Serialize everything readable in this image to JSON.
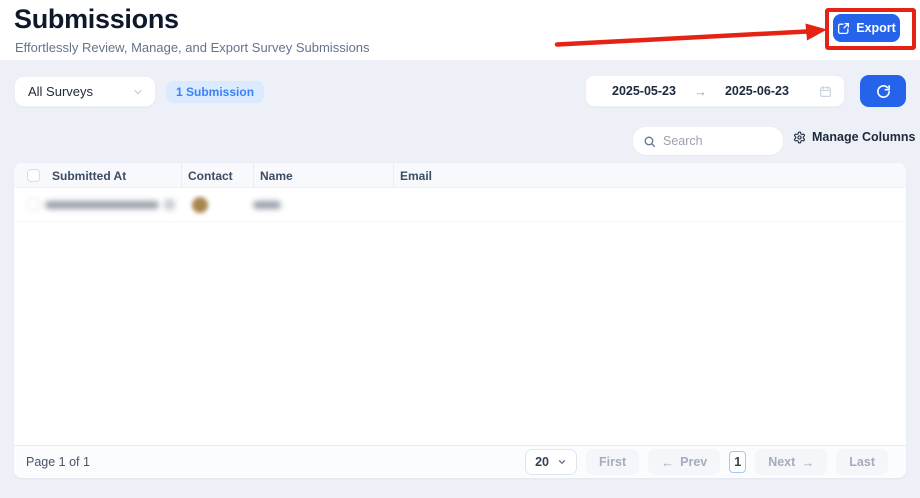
{
  "page": {
    "title": "Submissions",
    "subtitle": "Effortlessly Review, Manage, and Export Survey Submissions"
  },
  "toolbar": {
    "export_label": "Export"
  },
  "filters": {
    "survey_filter_value": "All Surveys",
    "submission_count": "1 Submission",
    "date_from": "2025-05-23",
    "date_to": "2025-06-23",
    "search_placeholder": "Search",
    "manage_columns_label": "Manage Columns"
  },
  "table": {
    "columns": [
      "Submitted At",
      "Contact",
      "Name",
      "Email"
    ]
  },
  "pagination": {
    "summary": "Page 1 of 1",
    "page_size": "20",
    "first": "First",
    "prev": "Prev",
    "current_page": "1",
    "next": "Next",
    "last": "Last"
  },
  "icons": {
    "range_arrow": "→",
    "prev_arrow": "←",
    "next_arrow": "→"
  },
  "colors": {
    "accent_blue": "#2563eb",
    "badge_bg": "#dbeafe",
    "badge_text": "#3b82f6",
    "annotation_red": "#e42315"
  }
}
